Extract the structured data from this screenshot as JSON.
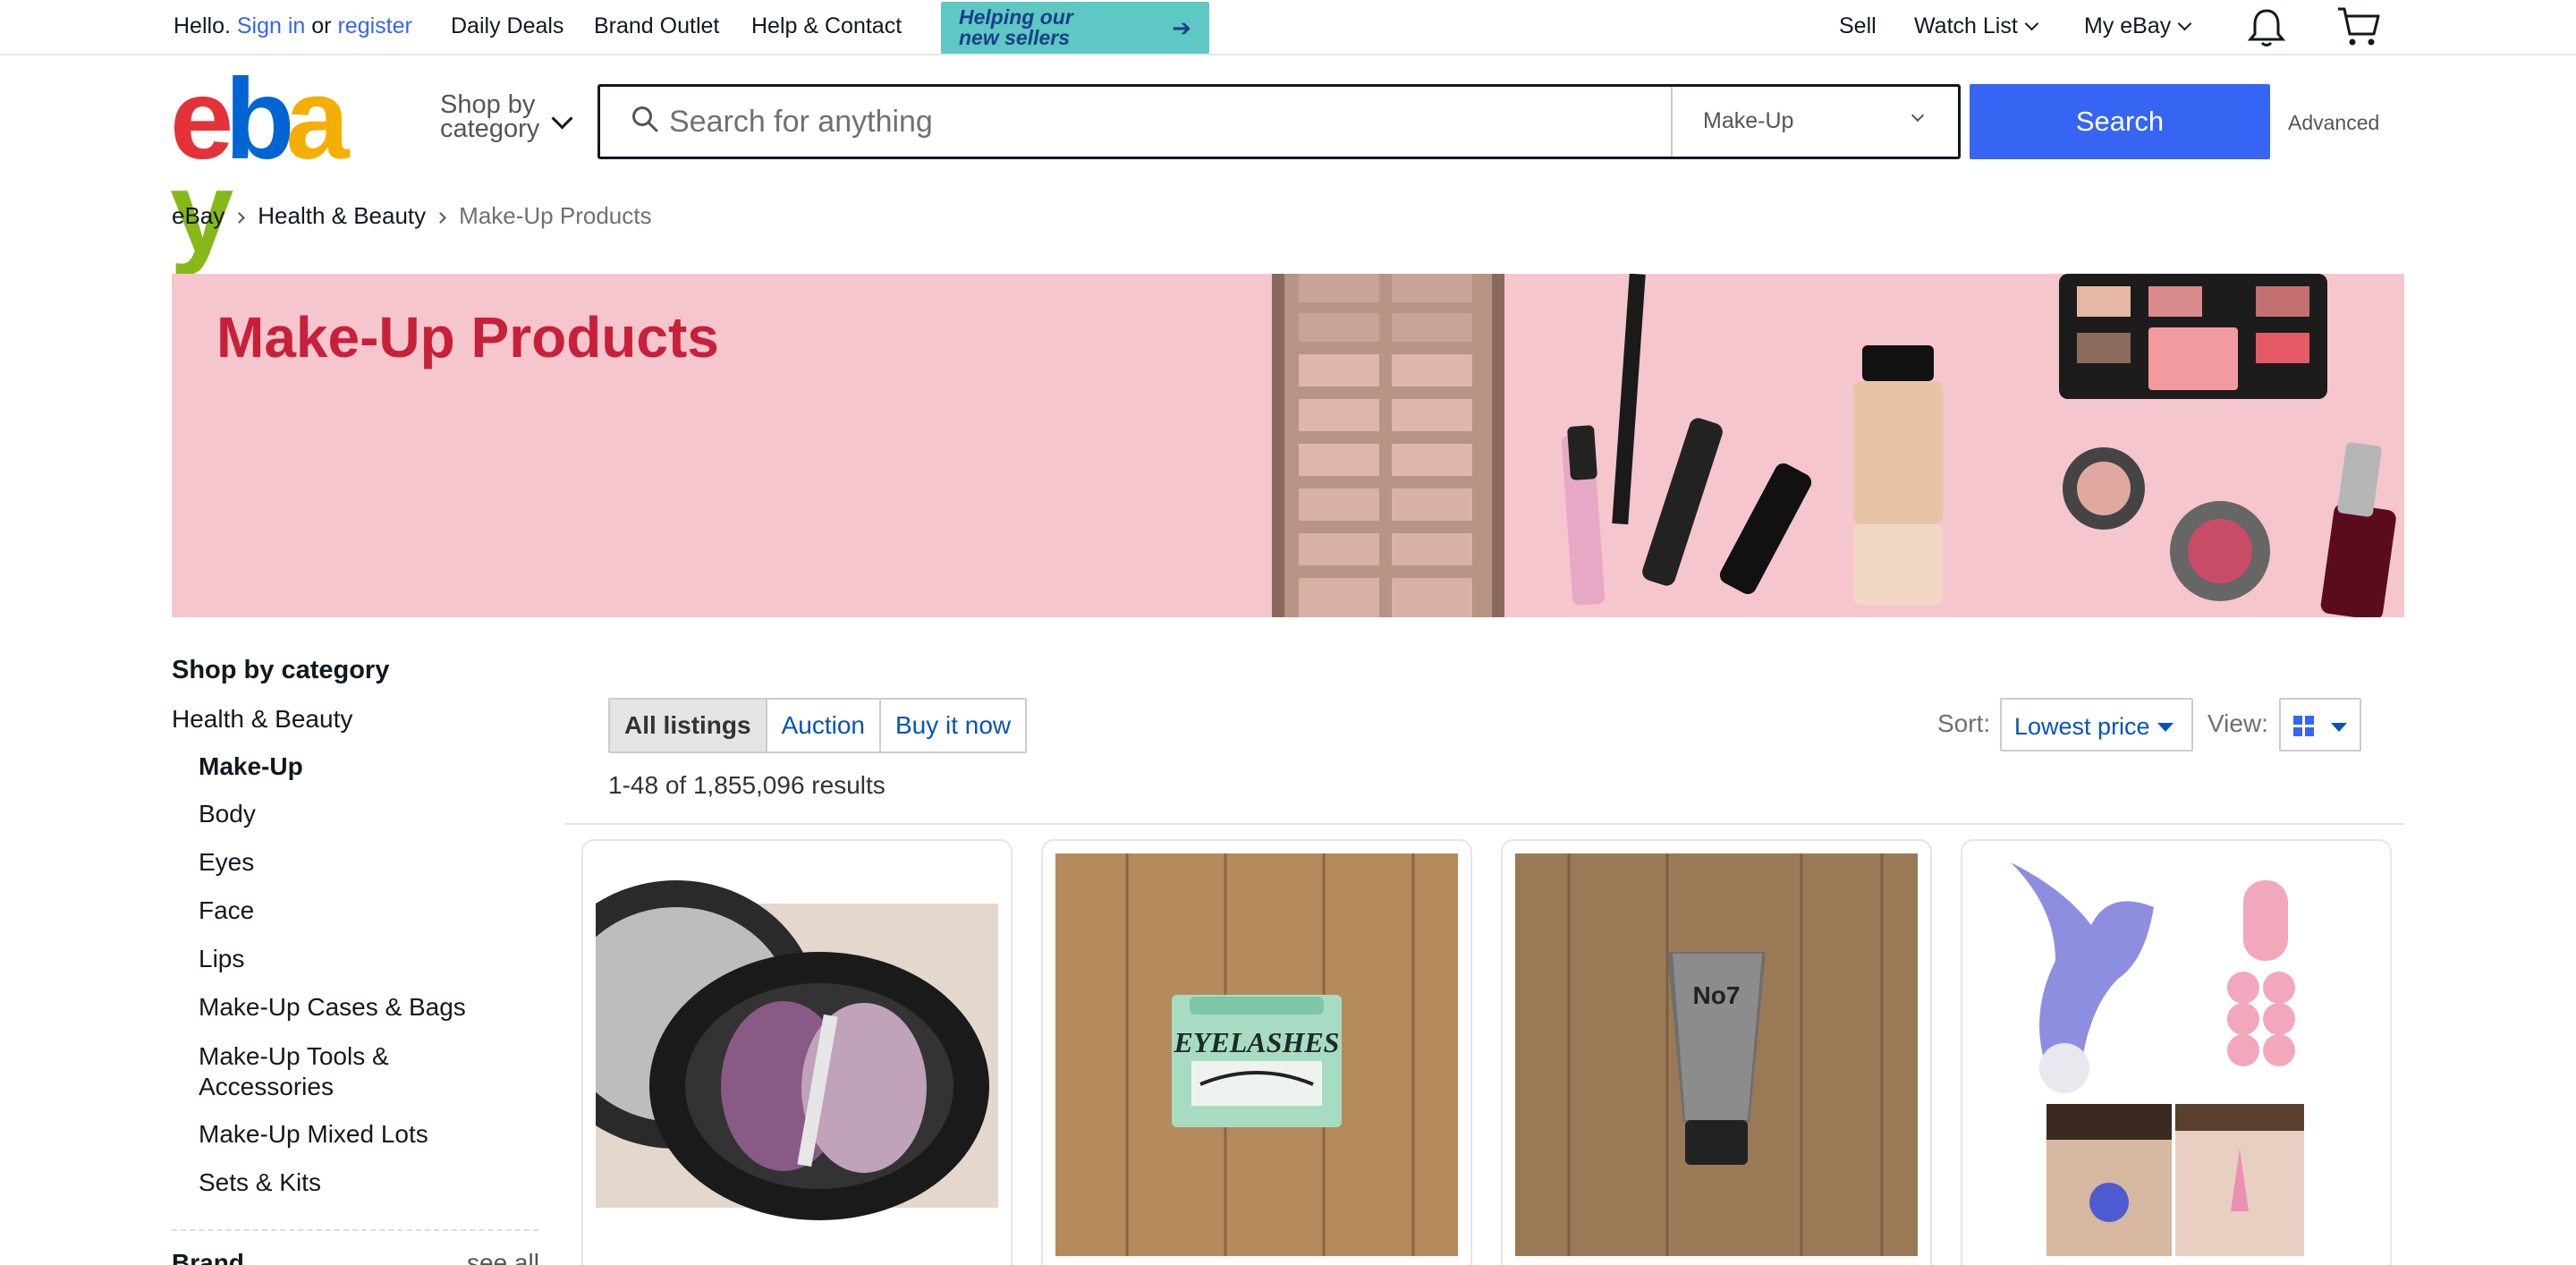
{
  "topbar": {
    "hello": "Hello.",
    "sign_in": "Sign in",
    "or": "or",
    "register": "register",
    "daily_deals": "Daily Deals",
    "brand_outlet": "Brand Outlet",
    "help_contact": "Help & Contact",
    "promo_line1": "Helping our",
    "promo_line2": "new sellers",
    "sell": "Sell",
    "watch_list": "Watch List",
    "my_ebay": "My eBay"
  },
  "header": {
    "shop_by_line1": "Shop by",
    "shop_by_line2": "category",
    "search_placeholder": "Search for anything",
    "category_selected": "Make-Up",
    "search_button": "Search",
    "advanced": "Advanced"
  },
  "breadcrumb": [
    "eBay",
    "Health & Beauty",
    "Make-Up Products"
  ],
  "banner": {
    "title": "Make-Up Products"
  },
  "sidebar": {
    "title": "Shop by category",
    "parent": "Health & Beauty",
    "current": "Make-Up",
    "items": [
      "Body",
      "Eyes",
      "Face",
      "Lips",
      "Make-Up Cases & Bags",
      "Make-Up Tools &",
      "Accessories",
      "Make-Up Mixed Lots",
      "Sets & Kits"
    ],
    "brand": "Brand",
    "see_all": "see all"
  },
  "main": {
    "tabs": [
      "All listings",
      "Auction",
      "Buy it now"
    ],
    "sort_label": "Sort:",
    "sort_value": "Lowest price",
    "view_label": "View:",
    "result_count": "1-48 of 1,855,096 results"
  },
  "product_images": [
    "eyeshadow-compact-image",
    "eyelashes-box-image",
    "no7-tube-image",
    "nose-clip-image"
  ],
  "product_labels": {
    "eyelashes": "EYELASHES",
    "no7": "No7"
  },
  "colors": {
    "link": "#3665f3",
    "search_button": "#3665f3",
    "banner_bg": "#f5c6cd",
    "banner_title": "#c8203a",
    "promo": "#5ec8c4"
  }
}
